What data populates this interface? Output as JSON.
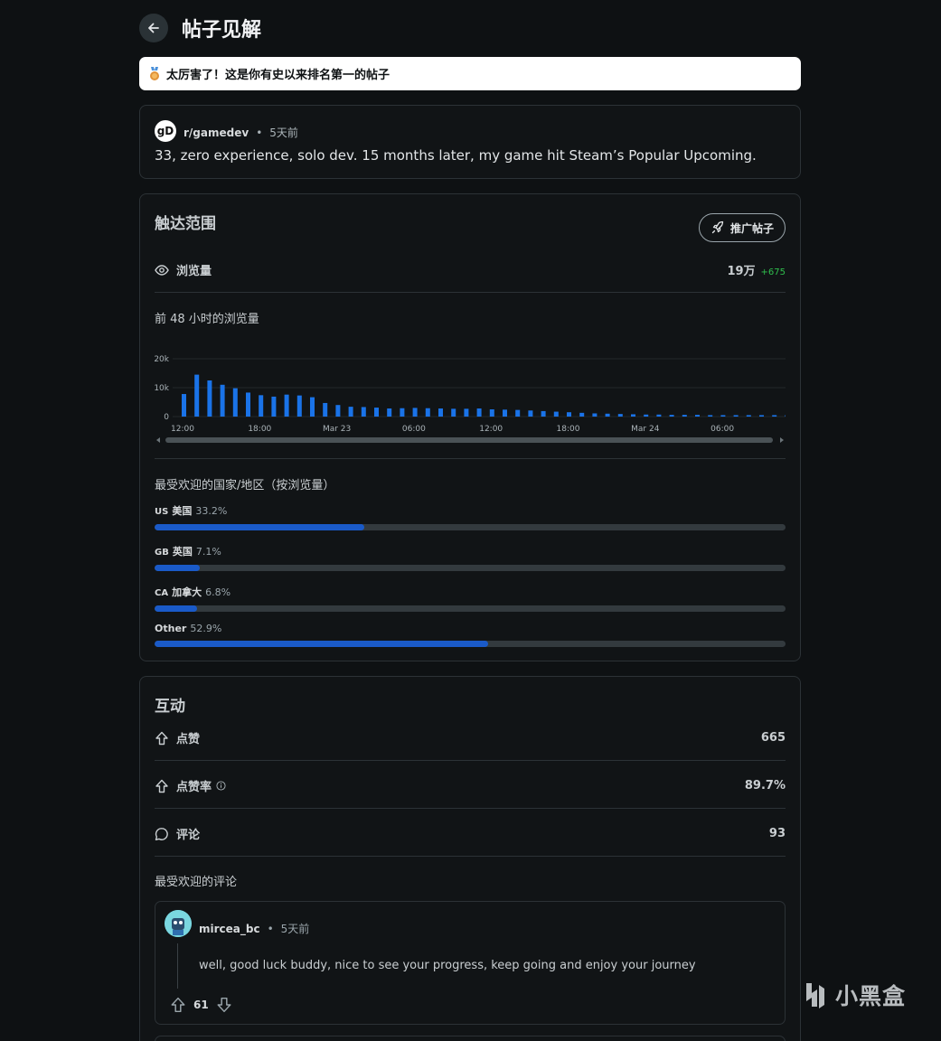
{
  "header": {
    "title": "帖子见解"
  },
  "banner": {
    "text": "太厉害了！这是你有史以来排名第一的帖子"
  },
  "post": {
    "avatar_text": "gD",
    "subreddit": "r/gamedev",
    "age": "5天前",
    "title": "33, zero experience, solo dev. 15 months later, my game hit Steam’s Popular Upcoming."
  },
  "reach": {
    "title": "触达范围",
    "promote_label": "推广帖子",
    "views_label": "浏览量",
    "views_value": "19万",
    "views_delta": "+675",
    "chart_title": "前 48 小时的浏览量",
    "countries_title": "最受欢迎的国家/地区（按浏览量）",
    "countries": [
      {
        "code": "US",
        "name": "美国",
        "pct_label": "33.2%",
        "pct": 33.2
      },
      {
        "code": "GB",
        "name": "英国",
        "pct_label": "7.1%",
        "pct": 7.1
      },
      {
        "code": "CA",
        "name": "加拿大",
        "pct_label": "6.8%",
        "pct": 6.8
      },
      {
        "code": "",
        "name": "Other",
        "pct_label": "52.9%",
        "pct": 52.9
      }
    ]
  },
  "chart_data": {
    "type": "bar",
    "y_ticks": [
      "20k",
      "10k",
      "0"
    ],
    "ylim": [
      0,
      20000
    ],
    "x_tick_labels": [
      "12:00",
      "18:00",
      "Mar 23",
      "06:00",
      "12:00",
      "18:00",
      "Mar 24",
      "06:00"
    ],
    "values": [
      7800,
      14500,
      12500,
      11000,
      9800,
      8300,
      7400,
      6900,
      7600,
      7300,
      6700,
      4700,
      4000,
      3400,
      3300,
      3100,
      2800,
      2900,
      3000,
      2900,
      2800,
      2700,
      2700,
      2800,
      2500,
      2400,
      2300,
      2100,
      1900,
      1700,
      1500,
      1300,
      1100,
      1000,
      900,
      800,
      700,
      700,
      600,
      600,
      600,
      500,
      500,
      500,
      500,
      500,
      500,
      500
    ],
    "bar_color": "#1a73e8"
  },
  "engagement": {
    "title": "互动",
    "upvotes_label": "点赞",
    "upvotes_value": "665",
    "ratio_label": "点赞率",
    "ratio_value": "89.7%",
    "comments_label": "评论",
    "comments_value": "93",
    "top_comments_title": "最受欢迎的评论",
    "top_comment": {
      "author": "mircea_bc",
      "age": "5天前",
      "text": "well, good luck buddy, nice to see your progress, keep going and enjoy your journey",
      "score": "61"
    }
  },
  "watermark": {
    "text": "小黑盒"
  },
  "colors": {
    "accent": "#1a5ac8",
    "positive": "#2fbf4d",
    "background": "#0e1113"
  }
}
